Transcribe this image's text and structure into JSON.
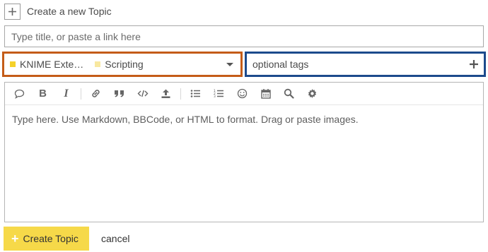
{
  "header": {
    "title": "Create a new Topic",
    "icon": "plus-icon"
  },
  "title_field": {
    "placeholder": "Type title, or paste a link here",
    "value": ""
  },
  "category": {
    "items": [
      {
        "label": "KNIME Exte…",
        "color": "#f5d12a"
      },
      {
        "label": "Scripting",
        "color": "#f8e8a0"
      }
    ],
    "border_color": "#c45c18"
  },
  "tags": {
    "placeholder": "optional tags",
    "border_color": "#1c4a8c"
  },
  "toolbar": {
    "buttons": [
      "comment-icon",
      "bold-icon",
      "italic-icon",
      "link-icon",
      "quote-icon",
      "code-icon",
      "upload-icon",
      "bullet-list-icon",
      "numbered-list-icon",
      "emoji-icon",
      "calendar-icon",
      "search-icon",
      "gear-icon"
    ]
  },
  "editor": {
    "placeholder": "Type here. Use Markdown, BBCode, or HTML to format. Drag or paste images."
  },
  "footer": {
    "create_label": "Create Topic",
    "cancel_label": "cancel",
    "create_color": "#f6d949"
  }
}
